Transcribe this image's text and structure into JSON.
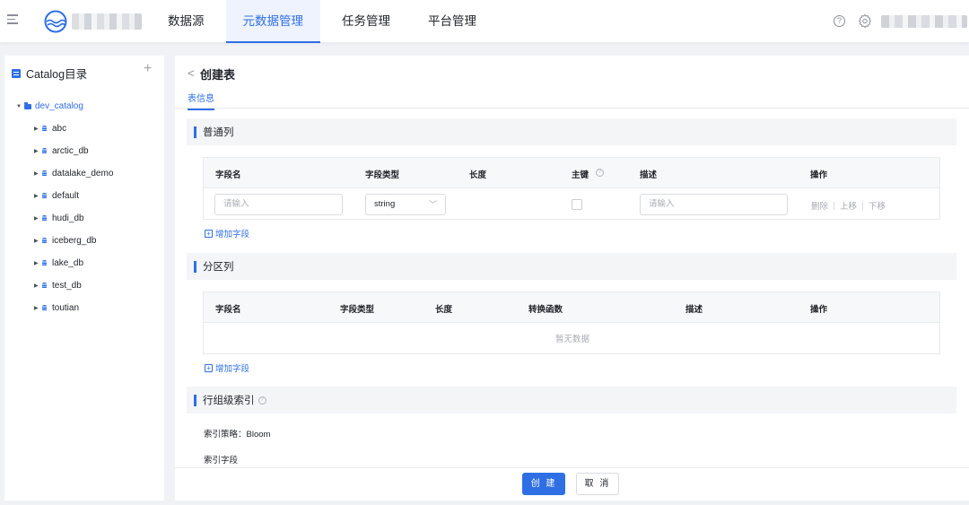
{
  "header": {
    "nav": [
      {
        "label": "数据源",
        "active": false
      },
      {
        "label": "元数据管理",
        "active": true
      },
      {
        "label": "任务管理",
        "active": false
      },
      {
        "label": "平台管理",
        "active": false
      }
    ],
    "help_icon_glyph": "?",
    "accent_color": "#2f6fe4",
    "icons": [
      "menu-toggle-icon",
      "logo",
      "help-icon",
      "gear-icon"
    ]
  },
  "sidebar": {
    "title": "Catalog目录",
    "add_glyph": "+",
    "root": {
      "label": "dev_catalog",
      "expanded": true
    },
    "databases": [
      "abc",
      "arctic_db",
      "datalake_demo",
      "default",
      "hudi_db",
      "iceberg_db",
      "lake_db",
      "test_db",
      "toutian"
    ]
  },
  "main": {
    "back_glyph": "<",
    "title": "创建表",
    "tab": "表信息",
    "normal_columns": {
      "title": "普通列",
      "headers": {
        "name": "字段名",
        "type": "字段类型",
        "length": "长度",
        "pk": "主键",
        "pk_help": "?",
        "desc": "描述",
        "ops": "操作"
      },
      "row": {
        "name_placeholder": "请输入",
        "type_value": "string",
        "pk_checked": false,
        "desc_placeholder": "请输入",
        "op_delete": "删除",
        "op_up": "上移",
        "op_down": "下移"
      },
      "add_label": "增加字段"
    },
    "partition_columns": {
      "title": "分区列",
      "headers": {
        "name": "字段名",
        "type": "字段类型",
        "length": "长度",
        "transform": "转换函数",
        "desc": "描述",
        "ops": "操作"
      },
      "empty_text": "暂无数据",
      "add_label": "增加字段"
    },
    "row_group_index": {
      "title": "行组级索引",
      "info_glyph": "?",
      "strategy_label": "索引策略：",
      "strategy_value": "Bloom",
      "fields_label": "索引字段"
    },
    "footer": {
      "create": "创 建",
      "cancel": "取 消"
    }
  }
}
